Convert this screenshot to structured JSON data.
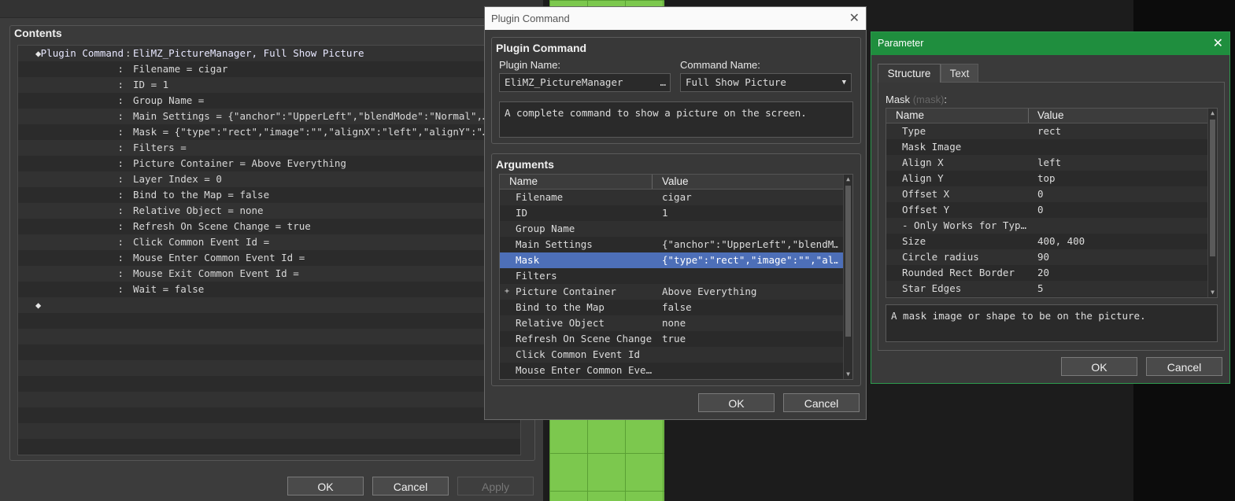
{
  "editor": {
    "contents_title": "Contents",
    "rows": [
      {
        "marker": "◆",
        "label": "Plugin Command",
        "text": "EliMZ_PictureManager, Full Show Picture"
      },
      {
        "label": ":",
        "text": "Filename = cigar"
      },
      {
        "label": ":",
        "text": "ID = 1"
      },
      {
        "label": ":",
        "text": "Group Name ="
      },
      {
        "label": ":",
        "text": "Main Settings = {\"anchor\":\"UpperLeft\",\"blendMode\":\"Normal\",…"
      },
      {
        "label": ":",
        "text": "Mask = {\"type\":\"rect\",\"image\":\"\",\"alignX\":\"left\",\"alignY\":\"…"
      },
      {
        "label": ":",
        "text": "Filters ="
      },
      {
        "label": ":",
        "text": "Picture Container = Above Everything"
      },
      {
        "label": ":",
        "text": "Layer Index = 0"
      },
      {
        "label": ":",
        "text": "Bind to the Map = false"
      },
      {
        "label": ":",
        "text": "Relative Object = none"
      },
      {
        "label": ":",
        "text": "Refresh On Scene Change = true"
      },
      {
        "label": ":",
        "text": "Click Common Event Id ="
      },
      {
        "label": ":",
        "text": "Mouse Enter Common Event Id ="
      },
      {
        "label": ":",
        "text": "Mouse Exit Common Event Id ="
      },
      {
        "label": ":",
        "text": "Wait = false"
      },
      {
        "marker": "◆",
        "label": "",
        "text": ""
      },
      {
        "label": "",
        "text": ""
      },
      {
        "label": "",
        "text": ""
      },
      {
        "label": "",
        "text": ""
      },
      {
        "label": "",
        "text": ""
      },
      {
        "label": "",
        "text": ""
      },
      {
        "label": "",
        "text": ""
      },
      {
        "label": "",
        "text": ""
      },
      {
        "label": "",
        "text": ""
      },
      {
        "label": "",
        "text": ""
      }
    ],
    "ok": "OK",
    "cancel": "Cancel",
    "apply": "Apply"
  },
  "plugin_command": {
    "window_title": "Plugin Command",
    "group_title": "Plugin Command",
    "plugin_name_label": "Plugin Name:",
    "plugin_name_value": "EliMZ_PictureManager",
    "browse": "…",
    "command_name_label": "Command Name:",
    "command_name_value": "Full Show Picture",
    "description": "A complete command to show a picture on the screen.",
    "arguments_title": "Arguments",
    "col_name": "Name",
    "col_value": "Value",
    "rows": [
      {
        "name": "Filename",
        "value": "cigar"
      },
      {
        "name": "ID",
        "value": "1"
      },
      {
        "name": "Group Name",
        "value": ""
      },
      {
        "name": "Main Settings",
        "value": "{\"anchor\":\"UpperLeft\",\"blendM…"
      },
      {
        "name": "Mask",
        "value": "{\"type\":\"rect\",\"image\":\"\",\"al…"
      },
      {
        "name": "Filters",
        "value": ""
      },
      {
        "name": "Picture Container",
        "value": "Above Everything",
        "expander": "+"
      },
      {
        "name": "Bind to the Map",
        "value": "false"
      },
      {
        "name": "Relative Object",
        "value": "none"
      },
      {
        "name": "Refresh On Scene Change",
        "value": "true"
      },
      {
        "name": "Click Common Event Id",
        "value": ""
      },
      {
        "name": "Mouse Enter Common Eve…",
        "value": ""
      }
    ],
    "selected_index": 4,
    "ok": "OK",
    "cancel": "Cancel"
  },
  "parameter": {
    "window_title": "Parameter",
    "tabs": [
      "Structure",
      "Text"
    ],
    "active_tab": 0,
    "mask_label": "Mask",
    "mask_key": "(mask)",
    "mask_colon": ":",
    "col_name": "Name",
    "col_value": "Value",
    "rows": [
      {
        "name": "Type",
        "value": "rect"
      },
      {
        "name": "Mask Image",
        "value": ""
      },
      {
        "name": "Align X",
        "value": "left"
      },
      {
        "name": "Align Y",
        "value": "top"
      },
      {
        "name": "Offset X",
        "value": "0"
      },
      {
        "name": "Offset Y",
        "value": "0"
      },
      {
        "name": "- Only Works for Typ…",
        "value": ""
      },
      {
        "name": "Size",
        "value": "400, 400"
      },
      {
        "name": "Circle radius",
        "value": "90"
      },
      {
        "name": "Rounded Rect Border",
        "value": "20"
      },
      {
        "name": "Star Edges",
        "value": "5"
      }
    ],
    "description": "A mask image or shape to be on the picture.",
    "ok": "OK",
    "cancel": "Cancel"
  }
}
